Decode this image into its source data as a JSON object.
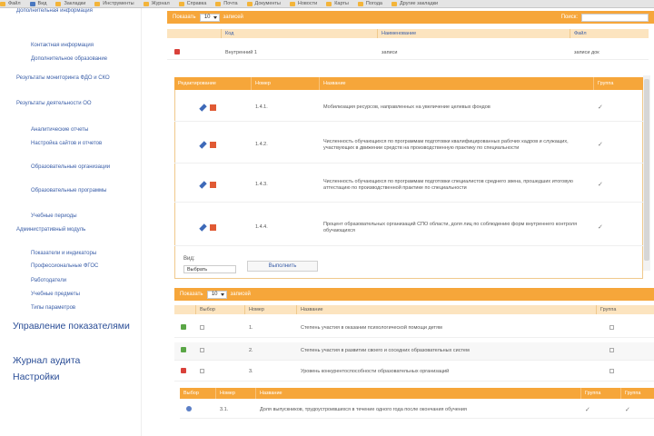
{
  "topbar": {
    "items": [
      {
        "label": "Файл",
        "icon": "folder-icon"
      },
      {
        "label": "Вид",
        "icon": "blue-page-icon"
      },
      {
        "label": "Закладки",
        "icon": "folder-icon"
      },
      {
        "label": "Инструменты",
        "icon": "folder-icon"
      },
      {
        "label": "Журнал",
        "icon": "folder-icon"
      },
      {
        "label": "Справка",
        "icon": "folder-icon"
      },
      {
        "label": "Почта",
        "icon": "folder-icon"
      },
      {
        "label": "Документы",
        "icon": "folder-icon"
      },
      {
        "label": "Новости",
        "icon": "folder-icon"
      },
      {
        "label": "Карты",
        "icon": "folder-icon"
      },
      {
        "label": "Погода",
        "icon": "folder-icon"
      },
      {
        "label": "Другие закладки",
        "icon": "folder-icon"
      }
    ]
  },
  "sidebar": {
    "items": [
      {
        "label": "Дополнительная информация"
      },
      {
        "label": "Контактная информация"
      },
      {
        "label": "Дополнительное образование"
      },
      {
        "label": "Результаты мониторинга ФДО и СКО"
      },
      {
        "label": "Результаты деятельности ОО"
      },
      {
        "label": "Аналитические отчеты"
      },
      {
        "label": "Настройка сайтов и отчетов"
      },
      {
        "label": "Образовательные организации"
      },
      {
        "label": "Образовательные программы"
      },
      {
        "label": "Учебные периоды"
      },
      {
        "label": "Административный модуль"
      },
      {
        "label": "Показатели и индикаторы"
      },
      {
        "label": "Профессиональные ФГОС"
      },
      {
        "label": "Работодатели"
      },
      {
        "label": "Учебные предметы"
      },
      {
        "label": "Типы параметров"
      }
    ],
    "big_items": [
      {
        "label": "Управление показателями"
      },
      {
        "label": "Журнал аудита"
      },
      {
        "label": "Настройки"
      }
    ]
  },
  "top_panel": {
    "show_label": "Показать",
    "show_value": "10",
    "records_label": "записей",
    "search_label": "Поиск:",
    "columns": [
      "",
      "Код",
      "Наименование",
      "Файл"
    ],
    "rows": [
      {
        "code": "Внутренний 1",
        "name": "записи",
        "file": "записи док"
      }
    ]
  },
  "middle_panel": {
    "columns": [
      "Редактирование",
      "Номер",
      "Название",
      "Группа"
    ],
    "rows": [
      {
        "number": "1.4.1.",
        "name": "Мобилизация ресурсов, направленных на увеличение целевых фондов"
      },
      {
        "number": "1.4.2.",
        "name": "Численность обучающихся по программам подготовки квалифицированных рабочих кадров и служащих, участвующих в движении средств на производственную практику по специальности"
      },
      {
        "number": "1.4.3.",
        "name": "Численность обучающихся по программам подготовки специалистов среднего звена, прошедших итоговую аттестацию по производственной практике по специальности"
      },
      {
        "number": "1.4.4.",
        "name": "Процент образовательных организаций СПО области, доля лиц по соблюдению форм внутреннего контроля обучающихся"
      }
    ],
    "group_label": "Вид:",
    "group_value": "Выбрать",
    "apply_button": "Выполнить"
  },
  "bottom_panel": {
    "show_label": "Показать",
    "show_value": "10",
    "records_label": "записей",
    "columns": [
      "",
      "Выбор",
      "Номер",
      "Название",
      "Группа"
    ],
    "rows": [
      {
        "status": "ok",
        "number": "1.",
        "name": "Степень участия в оказании психологической помощи детям"
      },
      {
        "status": "ok",
        "number": "2.",
        "name": "Степень участия в развитии своего и соседних образовательных систем"
      },
      {
        "status": "x",
        "number": "3.",
        "name": "Уровень конкурентоспособности образовательных организаций"
      }
    ],
    "sub_columns": [
      "Выбор",
      "Номер",
      "Название",
      "Группа",
      "Группа"
    ],
    "sub_rows": [
      {
        "number": "3.1.",
        "name": "Доля выпускников, трудоустроившихся в течение одного года после окончания обучения"
      }
    ]
  },
  "colors": {
    "accent": "#f6a63a",
    "header_bg": "#fce4bf",
    "link": "#3a5ea8"
  }
}
